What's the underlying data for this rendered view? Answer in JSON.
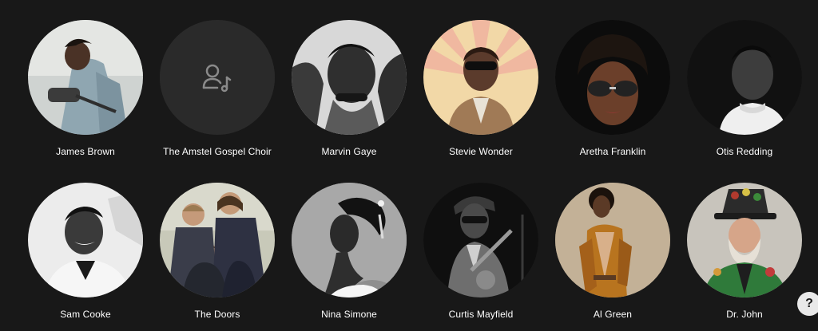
{
  "artists": [
    {
      "name": "James Brown"
    },
    {
      "name": "The Amstel Gospel Choir"
    },
    {
      "name": "Marvin Gaye"
    },
    {
      "name": "Stevie Wonder"
    },
    {
      "name": "Aretha Franklin"
    },
    {
      "name": "Otis Redding"
    },
    {
      "name": "Sam Cooke"
    },
    {
      "name": "The Doors"
    },
    {
      "name": "Nina Simone"
    },
    {
      "name": "Curtis Mayfield"
    },
    {
      "name": "Al Green"
    },
    {
      "name": "Dr. John"
    }
  ],
  "help": {
    "label": "?"
  },
  "colors": {
    "background": "#181818",
    "placeholder": "#2a2a2a",
    "text": "#ffffff"
  },
  "icons": {
    "placeholder": "artist-placeholder-icon"
  }
}
